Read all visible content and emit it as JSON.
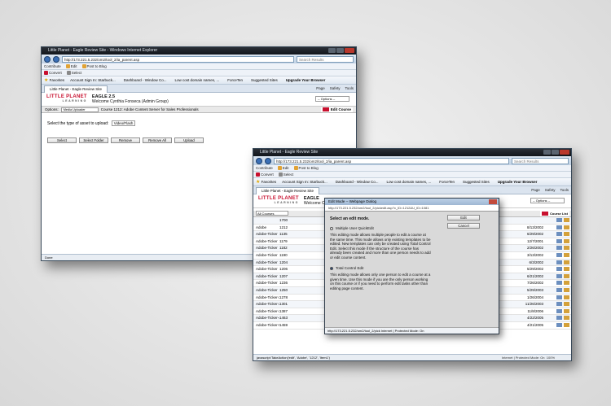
{
  "window1": {
    "title": "Little Planet - Eagle Review Site - Windows Internet Explorer",
    "url": "http://173.221.5.232/om2/tool_2/ia_parent.asp",
    "search_placeholder": "Search Results",
    "toolbar1": [
      "Contribute",
      "Edit",
      "Post to Blog"
    ],
    "toolbar2": [
      "Convert",
      "Select"
    ],
    "favorites_label": "Favorites",
    "favorites": [
      "Account Sign In: Starbuck...",
      "Dashboard - Window Co...",
      "Low cost domain names, ...",
      "ForceTen",
      "Suggested Sites",
      "Upgrade Your Browser"
    ],
    "tab_label": "Little Planet - Eagle Review Site",
    "commands": [
      "Page",
      "Safety",
      "Tools"
    ],
    "logo_main": "LITTLE PLANET",
    "logo_sub": "LEARNING",
    "app_name": "EAGLE 2.5",
    "welcome": "Welcome Cynthia Fonseca (Admin Group)",
    "options_placeholder": "-- Options --",
    "options_label": "Options:",
    "options_select": "Media Uploader",
    "course_label": "Course 1212: Adobe Content Server for Sales Professionals",
    "edit_course": "Edit Course",
    "upload_label": "Select the type of asset to upload:",
    "upload_type": "Video/Flash",
    "buttons": [
      "Select",
      "Select Folder",
      "Remove",
      "Remove All",
      "Upload"
    ],
    "status_left": "Done",
    "status_right": "Internet"
  },
  "window2": {
    "title": "Little Planet - Eagle Review Site",
    "url": "http://173.221.5.232/om2/tool_2/ia_parent.asp",
    "search_placeholder": "Search Results",
    "toolbar1": [
      "Contribute",
      "Edit",
      "Post to Blog"
    ],
    "toolbar2": [
      "Convert",
      "Select"
    ],
    "favorites_label": "Favorites",
    "favorites": [
      "Account Sign In: Starbuck...",
      "Dashboard - Window Co...",
      "Low cost domain names, ...",
      "ForceTen",
      "Suggested Sites",
      "Upgrade Your Browser"
    ],
    "tab_label": "Little Planet - Eagle Review Site",
    "commands": [
      "Page",
      "Safety",
      "Tools"
    ],
    "app_name": "EAGLE",
    "welcome": "Welcome C",
    "options_placeholder": "-- Options --",
    "course_filter": "All Courses",
    "course_list": "Course List",
    "rows": [
      {
        "name": "",
        "id": "1700",
        "date": ""
      },
      {
        "name": "Adobe",
        "id": "1212",
        "date": "8/13/2002"
      },
      {
        "name": "Adobe-Ticker",
        "id": "1135",
        "date": "6/29/2002"
      },
      {
        "name": "Adobe-Ticker",
        "id": "1179",
        "date": "12/7/2001"
      },
      {
        "name": "Adobe-Ticker",
        "id": "1182",
        "date": "2/26/2002"
      },
      {
        "name": "Adobe-Ticker",
        "id": "1190",
        "date": "3/13/2002"
      },
      {
        "name": "Adobe-Ticker",
        "id": "1204",
        "date": "6/3/2002"
      },
      {
        "name": "Adobe-Ticker",
        "id": "1206",
        "date": "5/29/2002"
      },
      {
        "name": "Adobe-Ticker",
        "id": "1207",
        "date": "6/21/2002"
      },
      {
        "name": "Adobe-Ticker",
        "id": "1236",
        "date": "7/26/2002"
      },
      {
        "name": "Adobe-Ticker",
        "id": "1250",
        "date": "5/29/2003"
      },
      {
        "name": "Adobe-Ticker-2",
        "id": "1278",
        "date": "1/26/2004"
      },
      {
        "name": "Adobe-Ticker-2",
        "id": "1301",
        "date": "11/26/2003"
      },
      {
        "name": "Adobe-Ticker-2",
        "id": "1387",
        "date": "11/8/2006"
      },
      {
        "name": "Adobe-Ticker-4",
        "id": "1463",
        "date": "4/22/2005"
      },
      {
        "name": "Adobe-Ticker-5",
        "id": "1459",
        "date": "4/21/2005"
      }
    ],
    "status_left": "javascript:TakeAction('edit', 'Adobe', '1212', 'Item1')",
    "status_right": "Internet | Protected Mode: On",
    "zoom": "100%"
  },
  "dialog": {
    "title": "Edit Mode -- Webpage Dialog",
    "url": "http://173.221.5.232/om2/tool_2/pickedit.asp?c_ID=1212&U_ID=1081",
    "heading": "Select an edit mode.",
    "option1": "Multiple User QuickEdit",
    "option1_desc": "This editing mode allows multiple people to edit a course at the same time. This mode allows only existing templates to be edited. New templates can only be created using Total Control Edit. Select this mode if the structure of the course has already been created and more than one person needs to add or edit course content.",
    "option2": "Total Control Edit",
    "option2_desc": "This editing mode allows only one person to edit a course at a given time. Use this mode if you are the only person working on this course or if you need to perform edit tasks other than editing page content.",
    "edit_button": "Edit",
    "cancel_button": "Cancel",
    "status": "http://173.221.5.232/om2/tool_2/pick   Internet | Protected Mode: On"
  }
}
